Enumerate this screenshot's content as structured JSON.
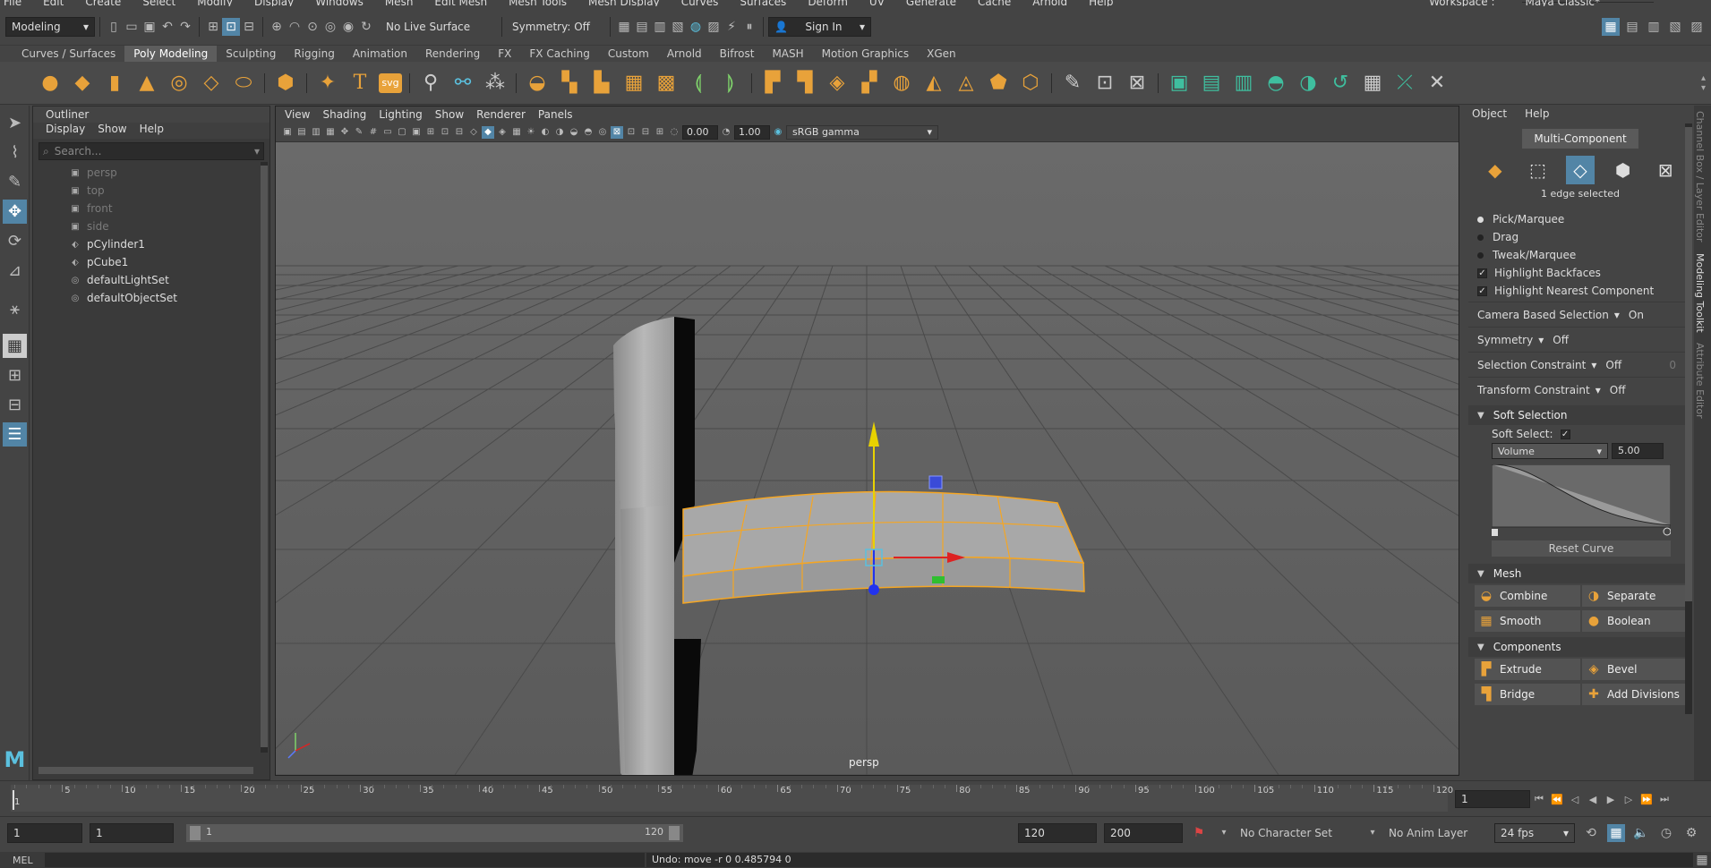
{
  "menubar": {
    "items": [
      "File",
      "Edit",
      "Create",
      "Select",
      "Modify",
      "Display",
      "Windows",
      "Mesh",
      "Edit Mesh",
      "Mesh Tools",
      "Mesh Display",
      "Curves",
      "Surfaces",
      "Deform",
      "UV",
      "Generate",
      "Cache",
      "Arnold",
      "Help"
    ],
    "workspace_label": "Workspace :",
    "workspace_value": "Maya Classic*"
  },
  "statusline": {
    "mode": "Modeling",
    "live_surface": "No Live Surface",
    "symmetry": "Symmetry: Off",
    "sign_in": "Sign In"
  },
  "shelf": {
    "tabs": [
      "Curves / Surfaces",
      "Poly Modeling",
      "Sculpting",
      "Rigging",
      "Animation",
      "Rendering",
      "FX",
      "FX Caching",
      "Custom",
      "Arnold",
      "Bifrost",
      "MASH",
      "Motion Graphics",
      "XGen"
    ],
    "active_tab": "Poly Modeling",
    "text_icon": "T",
    "svg_icon": "svg"
  },
  "outliner": {
    "title": "Outliner",
    "menu": [
      "Display",
      "Show",
      "Help"
    ],
    "search_placeholder": "Search...",
    "items": [
      {
        "label": "persp",
        "icon": "camera-icon",
        "dim": true
      },
      {
        "label": "top",
        "icon": "camera-icon",
        "dim": true
      },
      {
        "label": "front",
        "icon": "camera-icon",
        "dim": true
      },
      {
        "label": "side",
        "icon": "camera-icon",
        "dim": true
      },
      {
        "label": "pCylinder1",
        "icon": "mesh-icon",
        "dim": false
      },
      {
        "label": "pCube1",
        "icon": "mesh-icon",
        "dim": false
      },
      {
        "label": "defaultLightSet",
        "icon": "set-icon",
        "dim": false
      },
      {
        "label": "defaultObjectSet",
        "icon": "set-icon",
        "dim": false
      }
    ]
  },
  "viewport": {
    "menu": [
      "View",
      "Shading",
      "Lighting",
      "Show",
      "Renderer",
      "Panels"
    ],
    "exposure": "0.00",
    "gamma": "1.00",
    "color_space": "sRGB gamma",
    "camera_label": "persp"
  },
  "modeling_toolkit": {
    "menu": [
      "Object",
      "Help"
    ],
    "multi_component": "Multi-Component",
    "selection_status": "1 edge selected",
    "pick_modes": [
      {
        "label": "Pick/Marquee",
        "on": true
      },
      {
        "label": "Drag",
        "on": false
      },
      {
        "label": "Tweak/Marquee",
        "on": false
      }
    ],
    "checks": [
      {
        "label": "Highlight Backfaces",
        "on": true
      },
      {
        "label": "Highlight Nearest Component",
        "on": true
      }
    ],
    "options": [
      {
        "label": "Camera Based Selection",
        "value": "On"
      },
      {
        "label": "Symmetry",
        "value": "Off"
      },
      {
        "label": "Selection Constraint",
        "value": "Off"
      },
      {
        "label": "Transform Constraint",
        "value": "Off"
      }
    ],
    "selection_constraint_extra": "0",
    "soft_selection": {
      "header": "Soft Selection",
      "soft_select_label": "Soft Select:",
      "falloff_mode": "Volume",
      "radius": "5.00",
      "reset_curve": "Reset Curve"
    },
    "mesh": {
      "header": "Mesh",
      "buttons": [
        "Combine",
        "Separate",
        "Smooth",
        "Boolean"
      ]
    },
    "components": {
      "header": "Components",
      "buttons": [
        "Extrude",
        "Bevel",
        "Bridge",
        "Add Divisions"
      ]
    }
  },
  "sidetabs": [
    "Channel Box / Layer Editor",
    "Modeling Toolkit",
    "Attribute Editor"
  ],
  "timeline": {
    "ticks": [
      "5",
      "10",
      "15",
      "20",
      "25",
      "30",
      "35",
      "40",
      "45",
      "50",
      "55",
      "60",
      "65",
      "70",
      "75",
      "80",
      "85",
      "90",
      "95",
      "100",
      "105",
      "110",
      "115",
      "120"
    ],
    "start_frame": "1",
    "current_frame": "1"
  },
  "range": {
    "start": "1",
    "playback_start": "1",
    "slider_start": "1",
    "slider_end": "120",
    "playback_end": "120",
    "end": "200",
    "character_set": "No Character Set",
    "anim_layer": "No Anim Layer",
    "fps": "24 fps"
  },
  "cmdline": {
    "label": "MEL",
    "feedback": "Undo: move -r 0 0.485794 0"
  },
  "colors": {
    "accent": "#5285a6",
    "selection": "#f5a623",
    "icon_orange": "#e8a23a"
  }
}
